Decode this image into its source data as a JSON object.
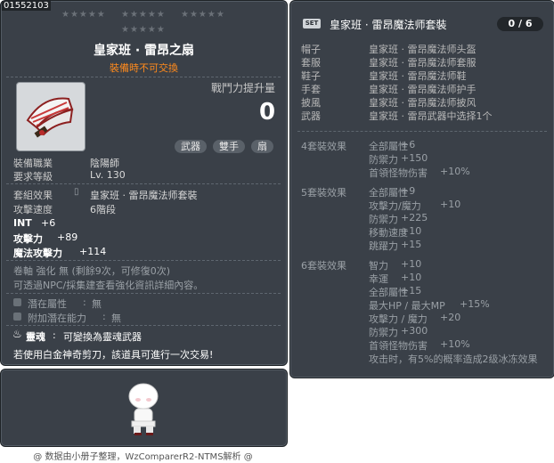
{
  "item": {
    "id": "01552103",
    "name": "皇家班 · 雷昂之扇",
    "trade_note": "裝備時不可交換",
    "power_label": "戰鬥力提升量",
    "power_value": "0",
    "tags": [
      "武器",
      "雙手",
      "扇"
    ],
    "job_label": "裝備職業",
    "job_value": "陰陽師",
    "level_label": "要求等級",
    "level_value": "Lv. 130",
    "set_label": "套組效果",
    "set_value": "皇家班 · 雷昂魔法师套裝",
    "speed_label": "攻擊速度",
    "speed_value": "6階段",
    "stats": [
      {
        "name": "INT",
        "value": "+6"
      },
      {
        "name": "攻擊力",
        "value": "+89"
      },
      {
        "name": "魔法攻擊力",
        "value": "+114"
      }
    ],
    "scroll_text": "卷軸 強化 無 (剩餘9次，可修復0次)",
    "enhance_text": "可透過NPC/採集建查看強化資訊詳細內容。",
    "potential_label": "潛在屬性",
    "potential_value": "無",
    "addl_potential_label": "附加潛在能力",
    "addl_potential_value": "無",
    "soul_label": "靈魂",
    "soul_value": "可變換為靈魂武器",
    "scissors_text": "若使用白金神奇剪刀，該道具可進行一次交易!"
  },
  "set": {
    "badge": "SET",
    "name": "皇家班 · 雷昂魔法师套裝",
    "count": "0 / 6",
    "pieces": [
      {
        "slot": "帽子",
        "name": "皇家班 · 雷昂魔法师头盔"
      },
      {
        "slot": "套服",
        "name": "皇家班 · 雷昂魔法师套服"
      },
      {
        "slot": "鞋子",
        "name": "皇家班 · 雷昂魔法师鞋"
      },
      {
        "slot": "手套",
        "name": "皇家班 · 雷昂魔法师护手"
      },
      {
        "slot": "披風",
        "name": "皇家班 · 雷昂魔法师披风"
      },
      {
        "slot": "武器",
        "name": "皇家班 · 雷昂武器中选择1个"
      }
    ],
    "bonuses": [
      {
        "label": "4套裝效果",
        "lines": [
          {
            "name": "全部屬性",
            "value": "+6"
          },
          {
            "name": "防禦力",
            "value": "+150"
          },
          {
            "name": "首領怪物伤害",
            "value": "+10%"
          }
        ]
      },
      {
        "label": "5套裝效果",
        "lines": [
          {
            "name": "全部屬性",
            "value": "+9"
          },
          {
            "name": "攻擊力/魔力",
            "value": "+10"
          },
          {
            "name": "防禦力",
            "value": "+225"
          },
          {
            "name": "移動速度",
            "value": "+10"
          },
          {
            "name": "跳躍力",
            "value": "+15"
          }
        ]
      },
      {
        "label": "6套裝效果",
        "lines": [
          {
            "name": "智力",
            "value": "+10"
          },
          {
            "name": "幸運",
            "value": "+10"
          },
          {
            "name": "全部屬性",
            "value": "+15"
          },
          {
            "name": "最大HP / 最大MP",
            "value": "+15%"
          },
          {
            "name": "攻擊力 / 魔力",
            "value": "+20"
          },
          {
            "name": "防禦力",
            "value": "+300"
          },
          {
            "name": "首領怪物伤害",
            "value": "+10%"
          },
          {
            "name": "攻击时，有5%的概率造成2级冰冻效果",
            "value": ""
          }
        ]
      }
    ]
  },
  "footer": "@ 数据由小册子整理，WzComparerR2-NTMS解析 @",
  "colors": {
    "panel": "#3a4048",
    "accent": "#ff8a1c",
    "text": "#d8d8d8"
  }
}
